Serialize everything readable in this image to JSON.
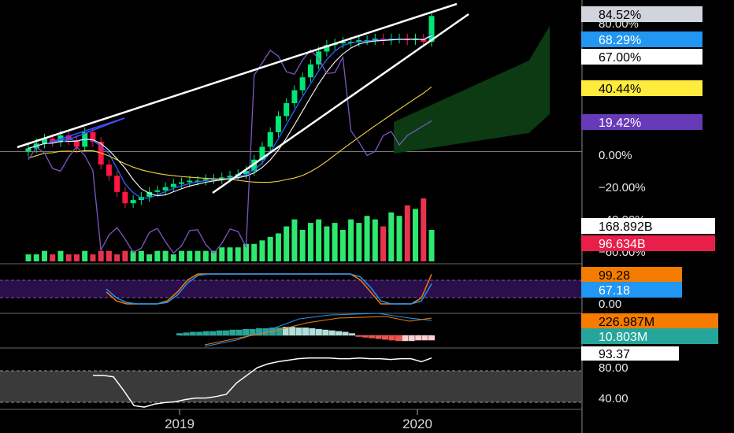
{
  "chart_data": {
    "type": "candlestick",
    "x_ticks": [
      "2019",
      "2020"
    ],
    "price_pane": {
      "scale": "log-percent",
      "axis_ticks": [
        "80.00%",
        "0.00%",
        "−20.00%",
        "−40.00%",
        "−60.00%"
      ],
      "value_tags": [
        {
          "label": "84.52%",
          "value": 84.52,
          "bg": "#d1d4dc",
          "fg": "#000000"
        },
        {
          "label": "68.29%",
          "value": 68.29,
          "bg": "#2196f3",
          "fg": "#ffffff"
        },
        {
          "label": "67.00%",
          "value": 67.0,
          "bg": "#ffffff",
          "fg": "#000000"
        },
        {
          "label": "40.44%",
          "value": 40.44,
          "bg": "#ffeb3b",
          "fg": "#000000"
        },
        {
          "label": "19.42%",
          "value": 19.42,
          "bg": "#673ab7",
          "fg": "#ffffff"
        }
      ],
      "weekly_closes_pct": [
        2,
        5,
        8,
        6,
        10,
        7,
        3,
        12,
        6,
        -8,
        -15,
        -25,
        -32,
        -30,
        -28,
        -25,
        -24,
        -22,
        -20,
        -19,
        -18,
        -18,
        -17,
        -17,
        -16,
        -15,
        -14,
        -12,
        -5,
        3,
        12,
        22,
        30,
        38,
        46,
        54,
        62,
        66,
        67,
        68,
        68,
        69,
        69,
        70,
        69,
        70,
        70,
        69,
        70,
        68,
        84
      ],
      "colors": {
        "up": "#00e676",
        "down": "#ff1744",
        "ma_fast": "#2962ff",
        "ma_slow": "#f5d442",
        "ma_white": "#ffffff",
        "rsi_line": "#7e57c2",
        "cloud": "#0c3a12"
      }
    },
    "volume": {
      "tags": [
        {
          "label": "168.892B",
          "bg": "#ffffff",
          "fg": "#000000"
        },
        {
          "label": "96.634B",
          "bg": "#e91e4a",
          "fg": "#ffffff"
        }
      ],
      "values": [
        2,
        2,
        3,
        2,
        3,
        2,
        2,
        3,
        2,
        3,
        3,
        2,
        3,
        3,
        3,
        2,
        3,
        3,
        2,
        3,
        3,
        3,
        3,
        3,
        4,
        4,
        4,
        5,
        5,
        6,
        7,
        8,
        10,
        12,
        9,
        11,
        12,
        10,
        11,
        9,
        12,
        11,
        13,
        12,
        10,
        14,
        13,
        16,
        15,
        18,
        9
      ]
    },
    "stoch_rsi": {
      "tags": [
        {
          "label": "99.28",
          "bg": "#f57c00",
          "fg": "#000000"
        },
        {
          "label": "67.18",
          "bg": "#2196f3",
          "fg": "#ffffff"
        }
      ],
      "axis_ticks": [
        "0.00"
      ],
      "k": [
        40,
        10,
        0,
        0,
        0,
        0,
        10,
        40,
        80,
        100,
        100,
        100,
        100,
        100,
        100,
        100,
        100,
        100,
        100,
        100,
        100,
        100,
        100,
        100,
        100,
        80,
        40,
        0,
        0,
        0,
        0,
        20,
        99
      ],
      "d": [
        50,
        20,
        5,
        0,
        0,
        0,
        5,
        30,
        70,
        95,
        100,
        100,
        100,
        100,
        100,
        100,
        100,
        100,
        100,
        100,
        100,
        100,
        100,
        100,
        100,
        90,
        55,
        10,
        0,
        0,
        0,
        10,
        67
      ]
    },
    "macd": {
      "tags": [
        {
          "label": "226.987M",
          "bg": "#f57c00",
          "fg": "#000000"
        },
        {
          "label": "10.803M",
          "bg": "#26a69a",
          "fg": "#ffffff"
        }
      ],
      "histogram": [
        3,
        4,
        5,
        5,
        6,
        6,
        7,
        7,
        8,
        8,
        9,
        9,
        10,
        10,
        11,
        11,
        12,
        12,
        11,
        11,
        10,
        9,
        8,
        7,
        6,
        5,
        3,
        -2,
        -3,
        -4,
        -5,
        -6,
        -7,
        -8,
        -8,
        -8,
        -7,
        -7,
        -7
      ]
    },
    "rsi": {
      "tags": [
        {
          "label": "93.37",
          "bg": "#ffffff",
          "fg": "#000000"
        }
      ],
      "axis_ticks": [
        "80.00",
        "40.00"
      ],
      "values": [
        70,
        70,
        68,
        50,
        30,
        28,
        32,
        34,
        35,
        38,
        40,
        40,
        42,
        45,
        60,
        70,
        80,
        85,
        88,
        90,
        92,
        93,
        93,
        93,
        92,
        92,
        93,
        92,
        92,
        91,
        92,
        92,
        88,
        93
      ]
    }
  }
}
